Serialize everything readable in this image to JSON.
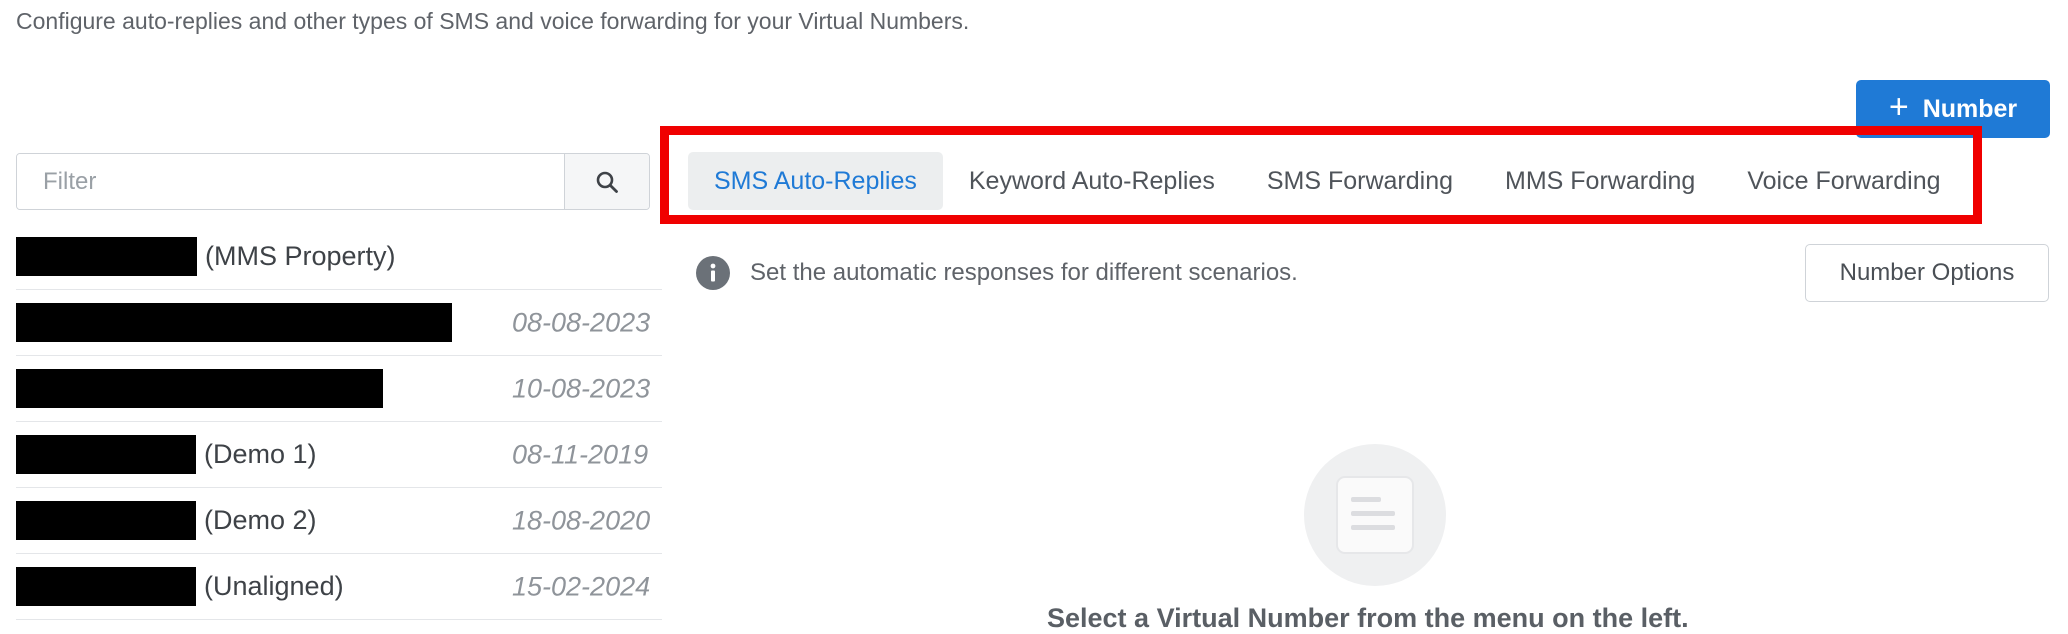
{
  "header": {
    "subtitle": "Configure auto-replies and other types of SMS and voice forwarding for your Virtual Numbers."
  },
  "actions": {
    "add_number_label": "Number",
    "add_icon": "plus-icon",
    "number_options_label": "Number Options"
  },
  "sidebar": {
    "filter_placeholder": "Filter",
    "search_icon": "search-icon",
    "items": [
      {
        "label": "(MMS Property)",
        "date": ""
      },
      {
        "label": "",
        "date": "08-08-2023"
      },
      {
        "label": "",
        "date": "10-08-2023"
      },
      {
        "label": "(Demo 1)",
        "date": "08-11-2019"
      },
      {
        "label": "(Demo 2)",
        "date": "18-08-2020"
      },
      {
        "label": "(Unaligned)",
        "date": "15-02-2024"
      }
    ]
  },
  "tabs": [
    {
      "label": "SMS Auto-Replies",
      "active": true
    },
    {
      "label": "Keyword Auto-Replies",
      "active": false
    },
    {
      "label": "SMS Forwarding",
      "active": false
    },
    {
      "label": "MMS Forwarding",
      "active": false
    },
    {
      "label": "Voice Forwarding",
      "active": false
    }
  ],
  "info": {
    "icon": "info-icon",
    "text": "Set the automatic responses for different scenarios."
  },
  "empty_state": {
    "icon": "document-icon",
    "text": "Select a Virtual Number from the menu on the left."
  },
  "colors": {
    "accent": "#1f7ad6",
    "highlight_frame": "#f00000",
    "redaction": "#000000"
  }
}
